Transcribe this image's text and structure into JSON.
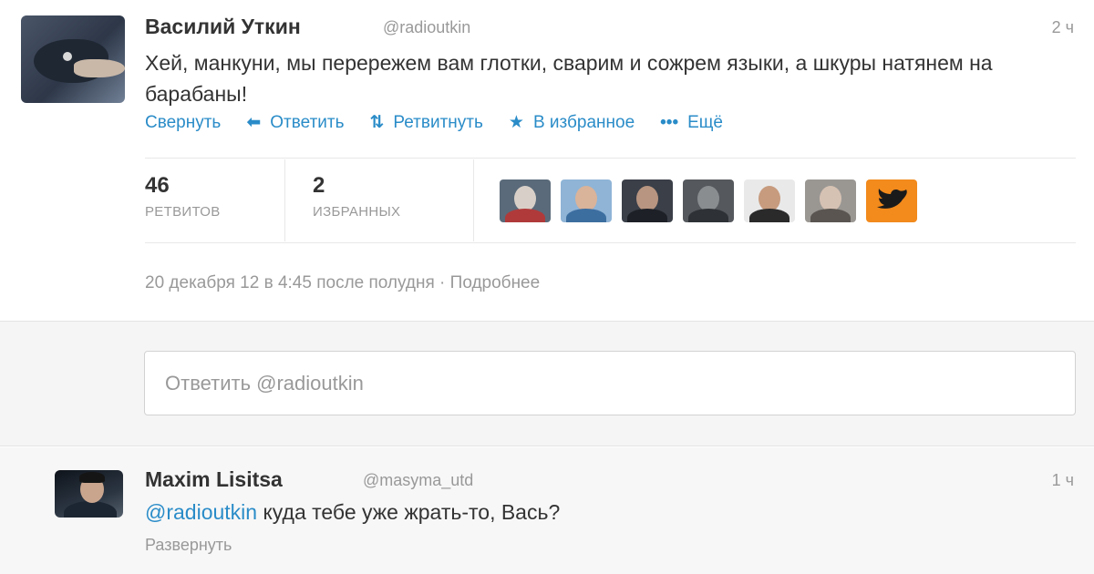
{
  "main_tweet": {
    "author_name": "Василий Уткин",
    "author_handle": "@radioutkin",
    "time": "2 ч",
    "text": "Хей, манкуни, мы перережем вам глотки, сварим и сожрем языки, а шкуры натянем на барабаны!",
    "actions": {
      "collapse": "Свернуть",
      "reply": "Ответить",
      "retweet": "Ретвитнуть",
      "favorite": "В избранное",
      "more": "Ещё"
    },
    "stats": {
      "retweets_count": "46",
      "retweets_label": "РЕТВИТОВ",
      "favorites_count": "2",
      "favorites_label": "ИЗБРАННЫХ"
    },
    "timestamp": "20 декабря 12 в 4:45 после полудня",
    "separator": " · ",
    "details_link": "Подробнее"
  },
  "reply_box": {
    "placeholder": "Ответить @radioutkin"
  },
  "reply_tweet": {
    "author_name": "Maxim Lisitsa",
    "author_handle": "@masyma_utd",
    "time": "1 ч",
    "mention": "@radioutkin",
    "text": " куда тебе уже жрать-то, Вась?",
    "expand": "Развернуть"
  },
  "colors": {
    "link": "#2a8cc8",
    "muted": "#999999",
    "text": "#333333",
    "reply_bg": "#f5f5f5"
  }
}
